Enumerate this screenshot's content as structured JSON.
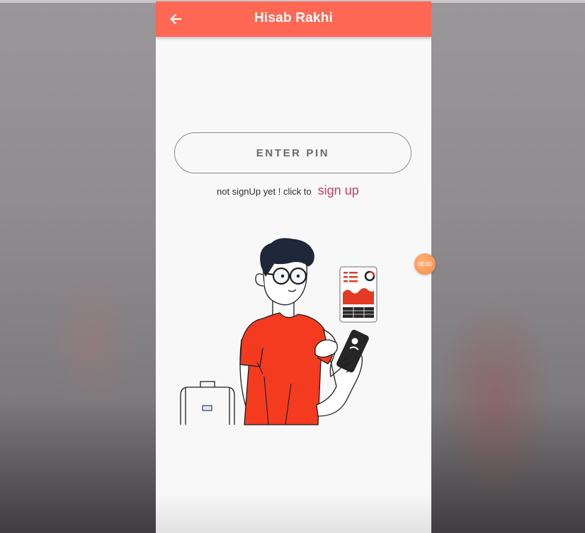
{
  "appbar": {
    "title": "Hisab Rakhi",
    "back_icon": "arrow-left-icon"
  },
  "pin_button": {
    "label": "ENTER PIN"
  },
  "signup": {
    "hint": "not signUp yet ! click to",
    "link": "sign up"
  },
  "overlay": {
    "timer": "00:00"
  },
  "colors": {
    "appbar": "#fe6753",
    "link": "#cf3b5f",
    "page_bg": "#f8f8f9",
    "backdrop": "#8e8b8e"
  }
}
